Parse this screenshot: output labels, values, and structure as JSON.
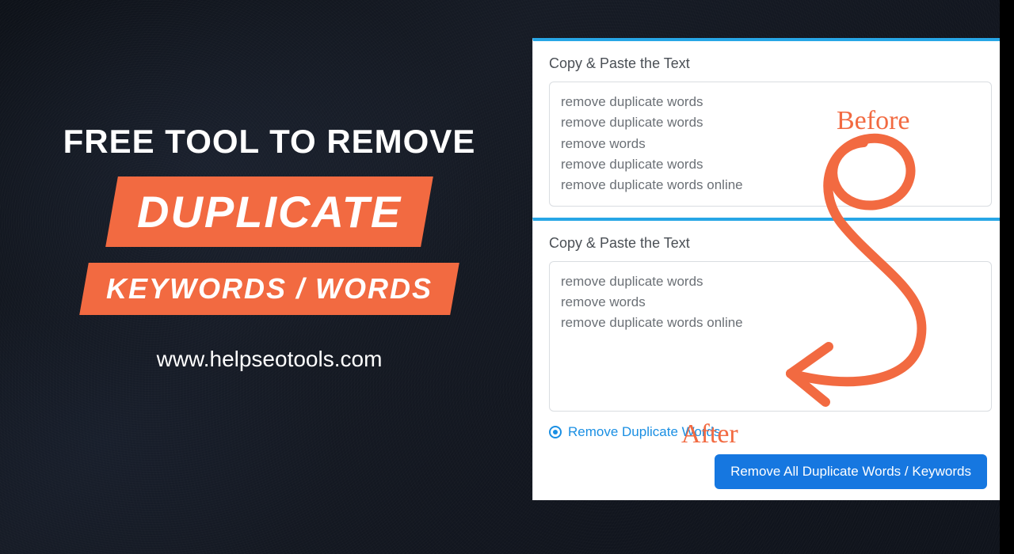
{
  "hero": {
    "line1": "Free Tool To Remove",
    "tag_big": "DUPLICATE",
    "tag_med": "KEYWORDS / WORDS",
    "site_url": "www.helpseotools.com"
  },
  "panel_before": {
    "label": "Copy & Paste the Text",
    "lines": [
      "remove duplicate words",
      "remove duplicate words",
      "remove words",
      "remove duplicate words",
      "remove duplicate words online"
    ]
  },
  "panel_after": {
    "label": "Copy & Paste the Text",
    "lines": [
      "remove duplicate words",
      "remove words",
      "remove duplicate words online"
    ],
    "radio_label": "Remove Duplicate Words",
    "button_label": "Remove All Duplicate Words / Keywords"
  },
  "annotations": {
    "before": "Before",
    "after": "After"
  },
  "colors": {
    "accent_orange": "#f26a41",
    "accent_blue": "#27a6e6",
    "button_blue": "#1677e0",
    "link_blue": "#1a8fe3"
  }
}
